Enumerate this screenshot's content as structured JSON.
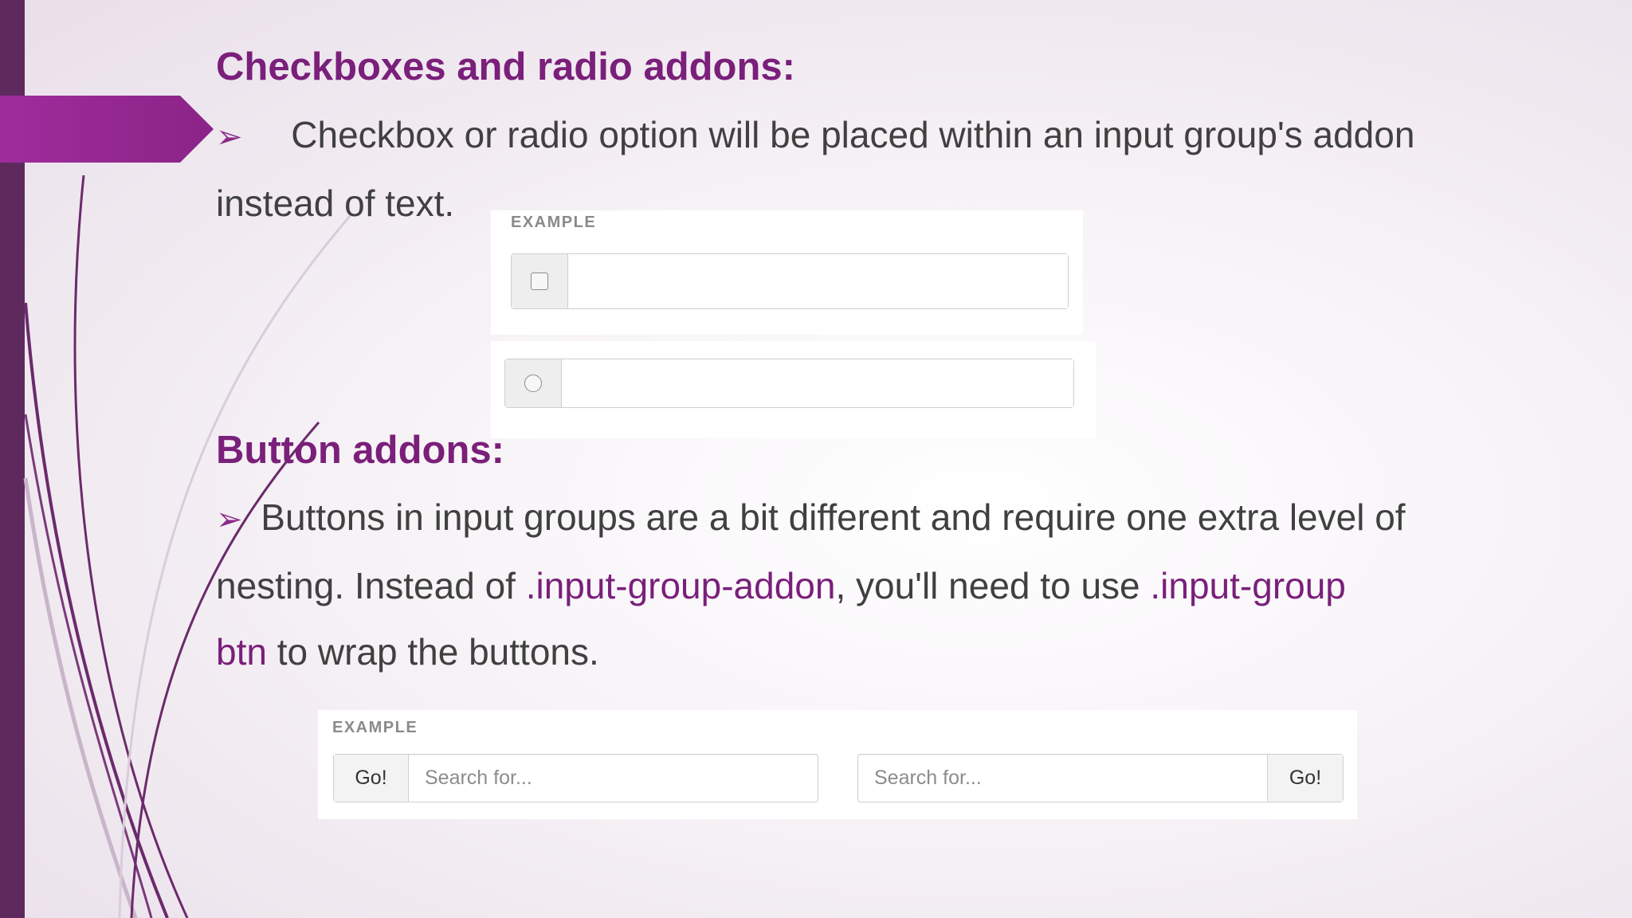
{
  "section1": {
    "title": "Checkboxes and radio addons:",
    "bullet": "➢",
    "line1": "Checkbox or radio option will be placed within an input group's addon",
    "line2": "instead of text."
  },
  "example1": {
    "label": "EXAMPLE"
  },
  "section2": {
    "title": "Button addons:",
    "bullet": "➢",
    "line1": "Buttons in input groups are a bit different and require one extra level of",
    "line2_pre": "nesting. Instead of ",
    "line2_code1": ".input-group-addon",
    "line2_mid": ", you'll need to use ",
    "line2_code2": ".input-group",
    "line3_code": "btn",
    "line3_post": " to wrap the buttons."
  },
  "example2": {
    "label": "EXAMPLE",
    "group1": {
      "button": "Go!",
      "placeholder": "Search for..."
    },
    "group2": {
      "button": "Go!",
      "placeholder": "Search for..."
    }
  },
  "colors": {
    "accent": "#7a1f7a",
    "sidebar": "#5e2a5e",
    "arrow": "#9b2d95",
    "text": "#404040"
  }
}
